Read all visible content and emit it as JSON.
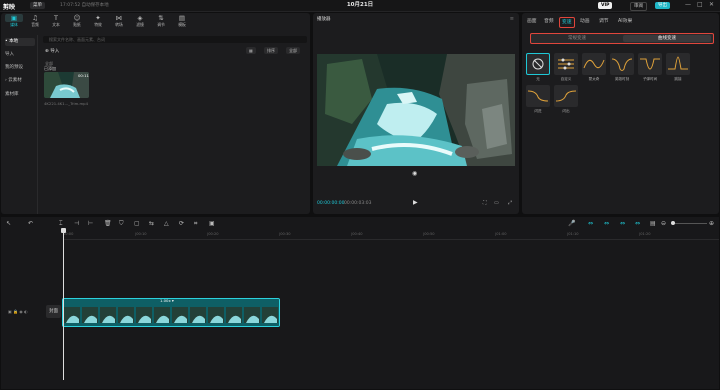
{
  "titlebar": {
    "app_name": "剪映",
    "menu_label": "菜单",
    "saved_text": "17:07:52 自动保存本地",
    "project_title": "10月21日",
    "vip_label": "VIP",
    "share_label": "审阅",
    "export_label": "导出",
    "window_controls": [
      "—",
      "□",
      "✕"
    ]
  },
  "media": {
    "toolbar": [
      {
        "label": "媒体",
        "icon": "▣"
      },
      {
        "label": "音频",
        "icon": "♫"
      },
      {
        "label": "文本",
        "icon": "T"
      },
      {
        "label": "贴纸",
        "icon": "☺"
      },
      {
        "label": "特效",
        "icon": "✦"
      },
      {
        "label": "转场",
        "icon": "⋈"
      },
      {
        "label": "滤镜",
        "icon": "◈"
      },
      {
        "label": "调节",
        "icon": "⇅"
      },
      {
        "label": "模板",
        "icon": "▤"
      }
    ],
    "side_items": [
      "• 本地",
      "导入",
      "我的预设",
      "› 云素材",
      "素材库"
    ],
    "search_placeholder": "搜索文件名称、画面元素、台词",
    "import_label": "导入",
    "filter_label": "全部",
    "sort_label": "排序",
    "view_label": "▦",
    "thumb_section": "全部",
    "thumb_tag": "已添加",
    "thumb_duration": "00:11",
    "thumb_name": "4K221.4K1..._Trim.mp4"
  },
  "player": {
    "header": "播放器",
    "time_current": "00:00:00:00",
    "time_total": "00:00:03:03",
    "play_icon": "▶"
  },
  "props": {
    "tabs": [
      "画面",
      "音频",
      "变速",
      "动画",
      "调节",
      "AI效果"
    ],
    "segments": [
      "常规变速",
      "曲线变速"
    ],
    "curves": [
      "无",
      "自定义",
      "蒙太奇",
      "英雄时刻",
      "子弹时间",
      "跳接",
      "闪进",
      "闪出"
    ]
  },
  "timeline": {
    "ruler": [
      "00:00",
      "|00:10",
      "|00:20",
      "|00:30",
      "|00:40",
      "|00:50",
      "|01:00",
      "|01:10",
      "|01:20"
    ],
    "clip_label": "1.00x ▾",
    "cover_label": "封面",
    "track_icons": "▣ 🔒 ◉ ◐"
  }
}
